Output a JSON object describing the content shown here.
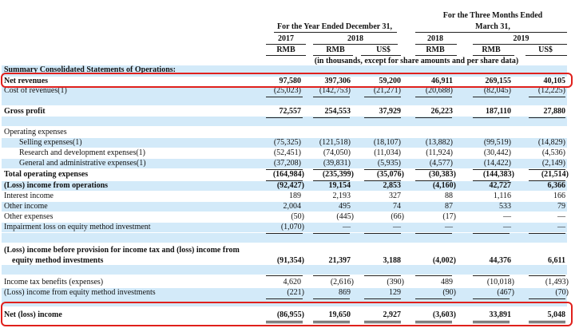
{
  "header": {
    "year_group": "For the Year Ended December 31,",
    "three_months_line1": "For the Three Months Ended",
    "three_months_line2": "March 31,",
    "year_2017": "2017",
    "year_2018a": "2018",
    "year_2018b": "2018",
    "year_2019": "2019",
    "cur": [
      "RMB",
      "RMB",
      "US$",
      "RMB",
      "RMB",
      "US$"
    ],
    "note": "(in thousands, except for share amounts and per share data)"
  },
  "section_title": "Summary Consolidated Statements of Operations:",
  "rows": {
    "net_revenues": {
      "label": "Net revenues",
      "v": [
        "97,580",
        "397,306",
        "59,200",
        "46,911",
        "269,155",
        "40,105"
      ]
    },
    "cost_of_revenues": {
      "label": "Cost of revenues(1)",
      "v": [
        "(25,023)",
        "(142,753)",
        "(21,271)",
        "(20,688)",
        "(82,045)",
        "(12,225)"
      ]
    },
    "gross_profit": {
      "label": "Gross profit",
      "v": [
        "72,557",
        "254,553",
        "37,929",
        "26,223",
        "187,110",
        "27,880"
      ]
    },
    "operating_expenses": {
      "label": "Operating expenses"
    },
    "selling": {
      "label": "Selling expenses(1)",
      "v": [
        "(75,325)",
        "(121,518)",
        "(18,107)",
        "(13,882)",
        "(99,519)",
        "(14,829)"
      ]
    },
    "rnd": {
      "label": "Research and development expenses(1)",
      "v": [
        "(52,451)",
        "(74,050)",
        "(11,034)",
        "(11,924)",
        "(30,442)",
        "(4,536)"
      ]
    },
    "gna": {
      "label": "General and administrative expenses(1)",
      "v": [
        "(37,208)",
        "(39,831)",
        "(5,935)",
        "(4,577)",
        "(14,422)",
        "(2,149)"
      ]
    },
    "total_opex": {
      "label": "Total operating expenses",
      "v": [
        "(164,984)",
        "(235,399)",
        "(35,076)",
        "(30,383)",
        "(144,383)",
        "(21,514)"
      ]
    },
    "op_income": {
      "label": "(Loss) income from operations",
      "v": [
        "(92,427)",
        "19,154",
        "2,853",
        "(4,160)",
        "42,727",
        "6,366"
      ]
    },
    "interest_income": {
      "label": "Interest income",
      "v": [
        "189",
        "2,193",
        "327",
        "88",
        "1,116",
        "166"
      ]
    },
    "other_income": {
      "label": "Other income",
      "v": [
        "2,004",
        "495",
        "74",
        "87",
        "533",
        "79"
      ]
    },
    "other_expenses": {
      "label": "Other expenses",
      "v": [
        "(50)",
        "(445)",
        "(66)",
        "(17)",
        "—",
        "—"
      ]
    },
    "impairment": {
      "label": "Impairment loss on equity method investment",
      "v": [
        "(1,070)",
        "—",
        "—",
        "—",
        "—",
        "—"
      ]
    },
    "pretax_line1": {
      "label": "(Loss) income before provision for income tax and (loss) income from"
    },
    "pretax_line2": {
      "label": "equity method investments",
      "v": [
        "(91,354)",
        "21,397",
        "3,188",
        "(4,002)",
        "44,376",
        "6,611"
      ]
    },
    "tax_benefit": {
      "label": "Income tax benefits (expenses)",
      "v": [
        "4,620",
        "(2,616)",
        "(390)",
        "489",
        "(10,018)",
        "(1,493)"
      ]
    },
    "equity_method": {
      "label": "(Loss) income from equity method investments",
      "v": [
        "(221)",
        "869",
        "129",
        "(90)",
        "(467)",
        "(70)"
      ]
    },
    "net_income": {
      "label": "Net (loss) income",
      "v": [
        "(86,955)",
        "19,650",
        "2,927",
        "(3,603)",
        "33,891",
        "5,048"
      ]
    }
  },
  "colors": {
    "shade": "#d3eaf9",
    "highlight": "#e0201c"
  }
}
